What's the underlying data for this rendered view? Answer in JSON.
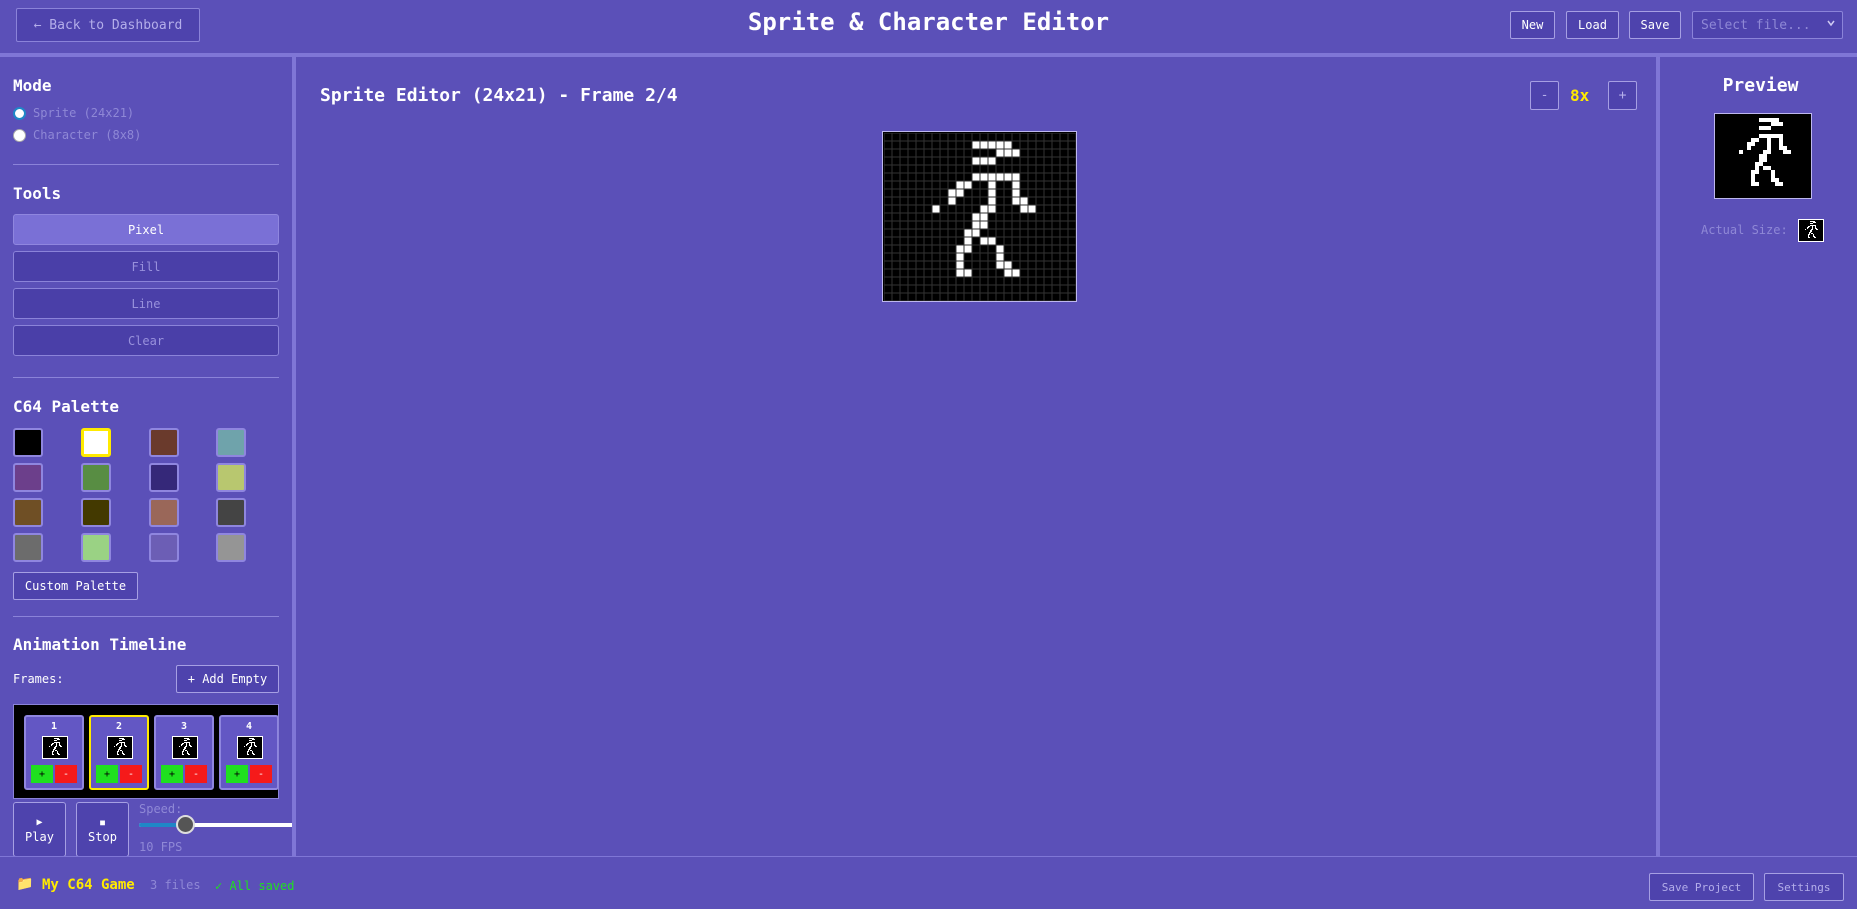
{
  "header": {
    "back_label": "← Back to Dashboard",
    "title": "Sprite & Character Editor",
    "new_label": "New",
    "load_label": "Load",
    "save_label": "Save",
    "file_select_placeholder": "Select file...",
    "file_select_icon": "chevron-down-icon"
  },
  "mode": {
    "title": "Mode",
    "options": [
      {
        "label": "Sprite (24x21)",
        "checked": true
      },
      {
        "label": "Character (8x8)",
        "checked": false
      }
    ]
  },
  "tools": {
    "title": "Tools",
    "items": [
      {
        "label": "Pixel",
        "active": true
      },
      {
        "label": "Fill",
        "active": false
      },
      {
        "label": "Line",
        "active": false
      },
      {
        "label": "Clear",
        "active": false
      }
    ]
  },
  "palette": {
    "title": "C64 Palette",
    "selected_index": 1,
    "colors": [
      "#000000",
      "#ffffff",
      "#6a3a2c",
      "#6fa3ab",
      "#6c3f8b",
      "#588d43",
      "#352879",
      "#b8c76f",
      "#6f4f25",
      "#433900",
      "#9a6759",
      "#444444",
      "#6c6c6c",
      "#9ad284",
      "#6c5eb5",
      "#959595"
    ],
    "custom_label": "Custom Palette"
  },
  "timeline": {
    "title": "Animation Timeline",
    "frames_label": "Frames:",
    "add_empty_label": "+ Add Empty",
    "frames": [
      {
        "number": "1",
        "active": false,
        "add_label": "+",
        "delete_label": "-"
      },
      {
        "number": "2",
        "active": true,
        "add_label": "+",
        "delete_label": "-"
      },
      {
        "number": "3",
        "active": false,
        "add_label": "+",
        "delete_label": "-"
      },
      {
        "number": "4",
        "active": false,
        "add_label": "+",
        "delete_label": "-"
      }
    ],
    "play_icon": "▶",
    "play_label": "Play",
    "stop_icon": "■",
    "stop_label": "Stop",
    "speed_label": "Speed:",
    "fps_label": "10 FPS",
    "speed_fraction": 0.3
  },
  "editor": {
    "title": "Sprite Editor (24x21) - Frame 2/4",
    "zoom_out_label": "-",
    "zoom_value": "8x",
    "zoom_in_label": "+",
    "sprite_pixels": [
      "........................",
      "...........#####........",
      "..............###.......",
      "...........###..........",
      "........................",
      "...........######.......",
      ".........##..#..#.......",
      "........##...#..#.......",
      "........#....#..##......",
      "......#.....##...##.....",
      "...........##...........",
      "...........##...........",
      "..........##............",
      "..........#.##..........",
      ".........##...#.........",
      ".........#....#.........",
      ".........#....##........",
      ".........##....##.......",
      "........................",
      "........................",
      "........................"
    ]
  },
  "preview": {
    "title": "Preview",
    "actual_size_label": "Actual Size:"
  },
  "footer": {
    "folder_icon": "📁",
    "project_name": "My C64 Game",
    "files_count": "3 files",
    "saved_status": "✓ All saved",
    "save_project_label": "Save Project",
    "settings_label": "Settings"
  }
}
